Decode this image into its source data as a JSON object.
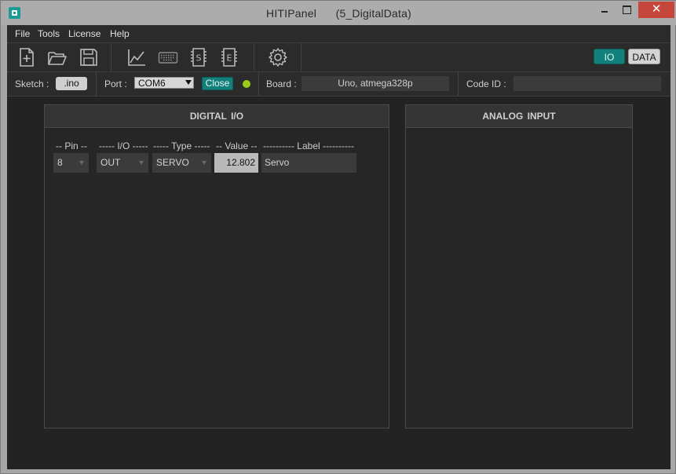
{
  "window": {
    "title": "HITIPanel      (5_DigitalData)",
    "minimize_label": "",
    "maximize_label": "",
    "close_label": "✕"
  },
  "menu": {
    "items": [
      "File",
      "Tools",
      "License",
      "Help"
    ]
  },
  "toolbar": {
    "icons": [
      "new-file-icon",
      "open-folder-icon",
      "save-icon",
      "chart-icon",
      "keyboard-icon",
      "s-chip-icon",
      "e-chip-icon",
      "gear-icon"
    ],
    "io_label": "IO",
    "data_label": "DATA",
    "io_active": true
  },
  "status": {
    "sketch_label": "Sketch :",
    "sketch_button": ".ino",
    "port_label": "Port :",
    "port_value": "COM6",
    "close_label": "Close",
    "connection_color": "#9acd1a",
    "board_label": "Board :",
    "board_value": "Uno, atmega328p",
    "codeid_label": "Code ID :",
    "codeid_value": ""
  },
  "digital": {
    "title": "DIGITAL  I/O",
    "headers": {
      "pin": "-- Pin --",
      "io": "----- I/O -----",
      "type": "----- Type -----",
      "value": "-- Value --",
      "label": "---------- Label ----------"
    },
    "rows": [
      {
        "pin": "8",
        "io": "OUT",
        "type": "SERVO",
        "value": "12.802",
        "label": "Servo"
      }
    ]
  },
  "analog": {
    "title": "ANALOG  INPUT"
  },
  "colors": {
    "accent": "#12807b",
    "background": "#232323",
    "panel": "#262626"
  }
}
